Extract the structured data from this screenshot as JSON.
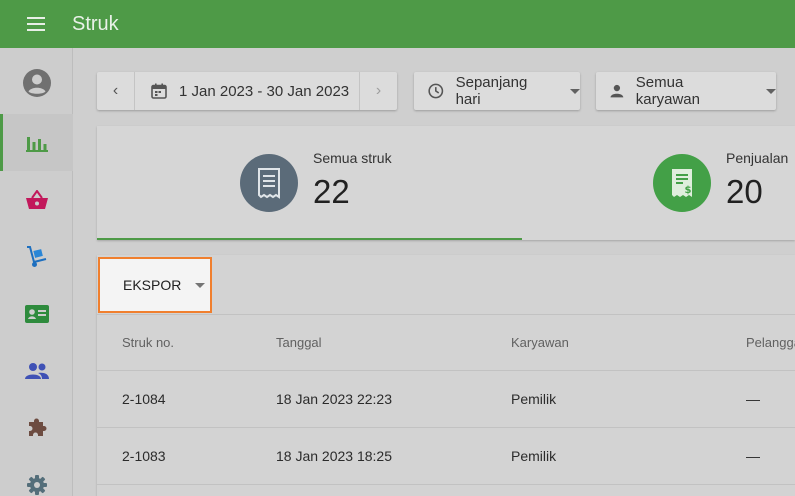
{
  "appbar": {
    "title": "Struk"
  },
  "sidebar": {
    "items": [
      {
        "name": "account",
        "icon": "account-circle-icon"
      },
      {
        "name": "reports",
        "icon": "bar-chart-icon",
        "active": true
      },
      {
        "name": "items",
        "icon": "basket-icon"
      },
      {
        "name": "inventory",
        "icon": "dolly-icon"
      },
      {
        "name": "customers",
        "icon": "id-card-icon"
      },
      {
        "name": "employees",
        "icon": "people-icon"
      },
      {
        "name": "integrations",
        "icon": "puzzle-icon"
      },
      {
        "name": "settings",
        "icon": "gear-icon"
      }
    ]
  },
  "filters": {
    "date_range": "1 Jan 2023 - 30 Jan 2023",
    "time_filter": "Sepanjang hari",
    "employee_filter": "Semua karyawan"
  },
  "summary": {
    "tabs": [
      {
        "label": "Semua struk",
        "value": "22",
        "color": "#5b6b79"
      },
      {
        "label": "Penjualan",
        "value": "20",
        "color": "#43a047"
      }
    ]
  },
  "table": {
    "export_label": "EKSPOR",
    "columns": [
      "Struk no.",
      "Tanggal",
      "Karyawan",
      "Pelanggan"
    ],
    "rows": [
      [
        "2-1084",
        "18 Jan 2023 22:23",
        "Pemilik",
        "—"
      ],
      [
        "2-1083",
        "18 Jan 2023 18:25",
        "Pemilik",
        "—"
      ]
    ]
  },
  "colors": {
    "accent": "#4e9a47",
    "highlight_border": "#f07f2e"
  }
}
